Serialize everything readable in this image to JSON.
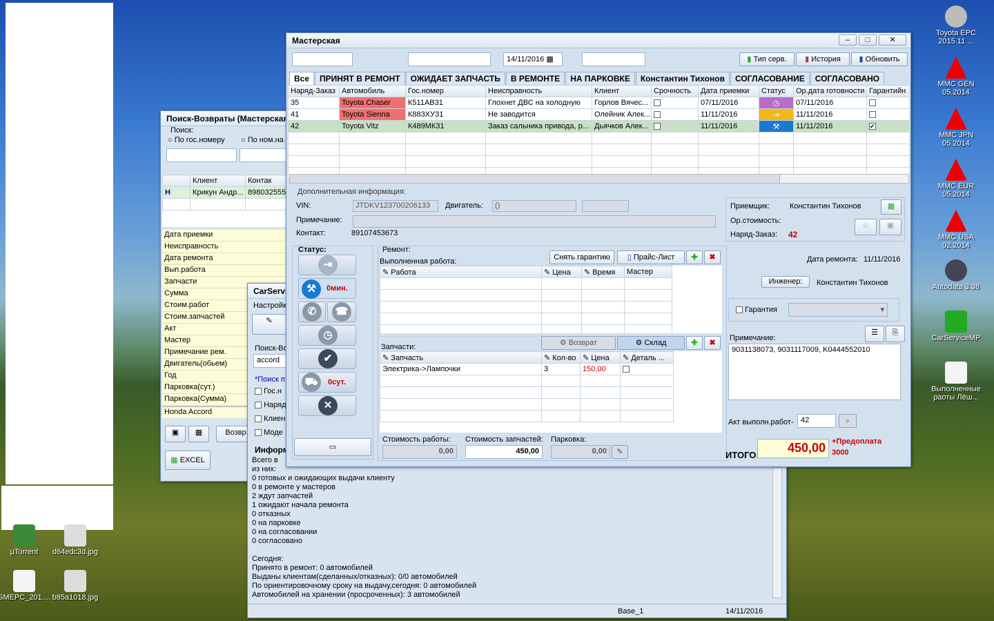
{
  "desktop": {
    "icons": [
      {
        "label": "Toyota EPC 2015.11 ...",
        "color": "#ccc"
      },
      {
        "label": "MMC GEN 05.2014",
        "color": "#e00"
      },
      {
        "label": "MMC JPN 05.2014",
        "color": "#e00"
      },
      {
        "label": "MMC EUR 05.2014",
        "color": "#e00"
      },
      {
        "label": "MMC USA 02.2014",
        "color": "#e00"
      },
      {
        "label": "Autodata 3.38",
        "color": "#888"
      },
      {
        "label": "CarServiceMP",
        "color": "#2a2"
      },
      {
        "label": "Выполненные раоты Лёш...",
        "color": "#fff"
      }
    ],
    "left_icons": [
      {
        "label": "µTorrent"
      },
      {
        "label": "d64edc3d.jpg"
      },
      {
        "label": "SMEPC_201...."
      },
      {
        "label": "b85a1018.jpg"
      }
    ]
  },
  "search": {
    "title": "Поиск-Возвраты (Мастерская",
    "search_label": "Поиск:",
    "radio1": "По гос.номеру",
    "radio2": "По ном.на",
    "col_client": "Клиент",
    "col_contact": "Контак",
    "row_mark": "Н",
    "row_client": "Крикун Андр...",
    "row_contact": "898032555",
    "fields": [
      "Дата приемки",
      "Неисправность",
      "Дата ремонта",
      "Вып.работа",
      "Запчасти",
      "Сумма",
      "Стоим.работ",
      "Стоим.запчастей",
      "Акт",
      "Мастер",
      "Примечание рем.",
      "Двигатель(обьем)",
      "Год",
      "Парковка(сут.)",
      "Парковка(Сумма)"
    ],
    "car": "Honda  Accord",
    "btn_return": "Возвр.",
    "btn_excel": "EXCEL"
  },
  "carservice": {
    "title": "CarServi",
    "settings": "Настройк",
    "search_label": "Поиск-Во",
    "search_value": "accord",
    "hint": "*Поиск п",
    "checks": [
      "Гос.н",
      "Наряд",
      "Клиен",
      "Моде"
    ],
    "info_title": "Информ",
    "info_lines": [
      "Всего в",
      "из них:",
      "0 готовых и ожидающих выдачи клиенту",
      "0 в ремонте у мастеров",
      "2 ждут запчастей",
      "1 ожидают начала ремонта",
      "0 отказных",
      "0 на парковке",
      "0 на согласовании",
      "0 согласовано",
      "",
      "Сегодня:",
      "Принято в ремонт: 0 автомобилей",
      "Выданы клиентам(сделанных/отказных): 0/0 автомобилей",
      "По ориентировочному сроку на выдачу,сегодня:  0 автомобилей",
      "Автомобилей на хранении (просроченных): 3 автомобилей"
    ],
    "status_base": "Base_1",
    "status_date": "14/11/2016"
  },
  "main": {
    "title": "Мастерская",
    "date": "14/11/2016",
    "btn_type": "Тип серв.",
    "btn_history": "История",
    "btn_refresh": "Обновить",
    "tabs": [
      "Все",
      "ПРИНЯТ В РЕМОНТ",
      "ОЖИДАЕТ ЗАПЧАСТЬ",
      "В РЕМОНТЕ",
      "НА ПАРКОВКЕ",
      "Константин Тихонов",
      "СОГЛАСОВАНИЕ",
      "СОГЛАСОВАНО"
    ],
    "columns": [
      "Наряд-Заказ",
      "Автомобиль",
      "Гос.номер",
      "Неисправность",
      "Клиент",
      "Срочность",
      "Дата приемки",
      "Статус",
      "Ор.дата готовности",
      "Гарантийн"
    ],
    "rows": [
      {
        "id": "35",
        "car": "Toyota  Chaser",
        "plate": "К511АВ31",
        "issue": "Глохнет ДВС на холодную",
        "client": "Горлов Вячес...",
        "date": "07/11/2016",
        "ready": "07/11/2016",
        "warranty": false
      },
      {
        "id": "41",
        "car": "Toyota  Sienna",
        "plate": "К883ХУ31",
        "issue": "Не заводится",
        "client": "Олейник Алек...",
        "date": "11/11/2016",
        "ready": "11/11/2016",
        "warranty": false
      },
      {
        "id": "42",
        "car": "Toyota  Vitz",
        "plate": "К489МК31",
        "issue": "Заказ сальника привода, р...",
        "client": "Дьячков Алек...",
        "date": "11/11/2016",
        "ready": "11/11/2016",
        "warranty": true
      }
    ],
    "extra_title": "Дополнительная информация:",
    "vin_label": "VIN:",
    "vin": "JTDKV123700206133",
    "engine_label": "Двигатель:",
    "engine": "()",
    "note_label": "Примечание:",
    "contact_label": "Контакт:",
    "contact": "89107453673",
    "receiver_label": "Приемщик:",
    "receiver": "Константин Тихонов",
    "cost_label": "Ор.стоимость:",
    "order_label": "Наряд-Заказ:",
    "order": "42",
    "status_label": "Статус:",
    "status_time1": "0мин.",
    "status_time2": "0сут.",
    "repair_label": "Ремонт:",
    "done_label": "Выполненная работа:",
    "btn_unwarranty": "Снять гарантию",
    "btn_price": "Прайс-Лист",
    "work_cols": [
      "Работа",
      "Цена",
      "Время",
      "Мастер"
    ],
    "parts_label": "Запчасти:",
    "btn_return": "Возврат",
    "btn_stock": "Склад",
    "parts_cols": [
      "Запчасть",
      "Кол-во",
      "Цена",
      "Деталь ..."
    ],
    "part": {
      "name": "Электрика->Лампочки",
      "qty": "3",
      "price": "150,00"
    },
    "repair_date_label": "Дата ремонта:",
    "repair_date": "11/11/2016",
    "engineer_btn": "Инженер:",
    "engineer": "Константин Тихонов",
    "warranty_label": "Гарантия",
    "note2_label": "Примечание:",
    "note2": "9031138073, 9031117009, K0444552010",
    "act_label": "Акт выполн.работ-",
    "act": "42",
    "work_cost_label": "Стоимость работы:",
    "work_cost": "0,00",
    "parts_cost_label": "Стоимость запчастей:",
    "parts_cost": "450,00",
    "parking_label": "Парковка:",
    "parking_cost": "0,00",
    "total_label": "ИТОГО:",
    "total": "450,00",
    "prepay1": "+Предоплата",
    "prepay2": "3000"
  }
}
